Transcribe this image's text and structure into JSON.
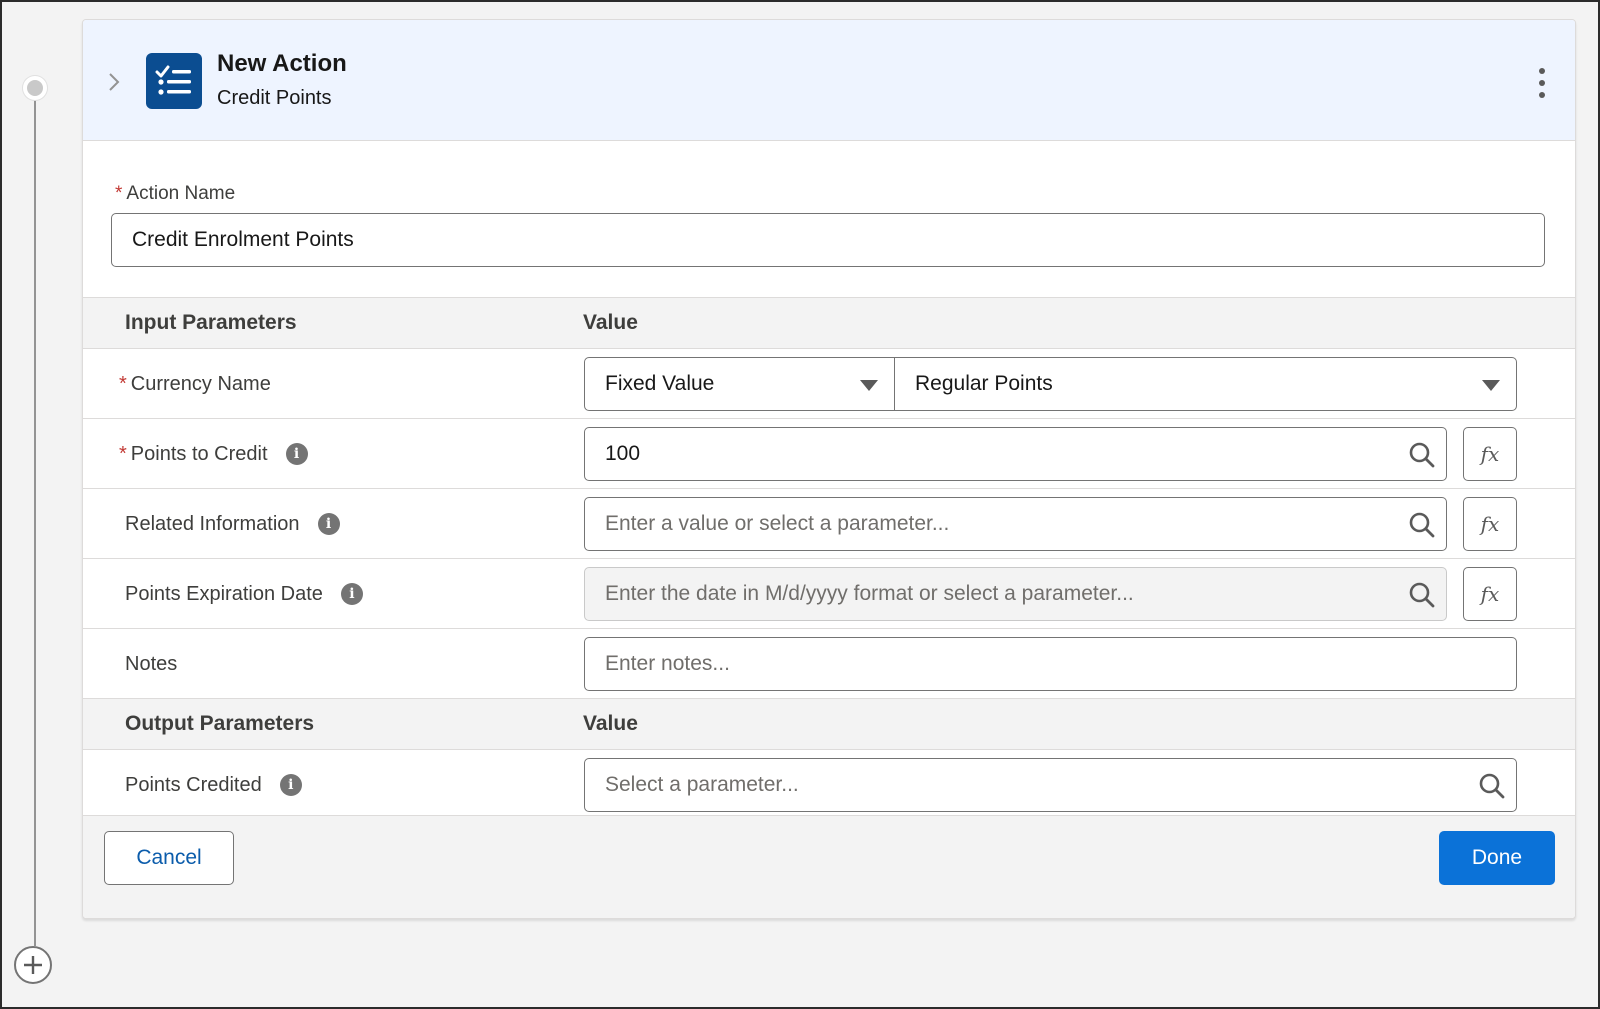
{
  "header": {
    "title": "New Action",
    "subtitle": "Credit Points"
  },
  "action_name": {
    "label": "Action Name",
    "value": "Credit Enrolment Points"
  },
  "input_section": {
    "col1": "Input Parameters",
    "col2": "Value"
  },
  "inputs": {
    "currency": {
      "label": "Currency Name",
      "type_value": "Fixed Value",
      "value": "Regular Points"
    },
    "points_to_credit": {
      "label": "Points to Credit",
      "value": "100"
    },
    "related_info": {
      "label": "Related Information",
      "placeholder": "Enter a value or select a parameter..."
    },
    "expiration": {
      "label": "Points Expiration Date",
      "placeholder": "Enter the date in M/d/yyyy format or select a parameter..."
    },
    "notes": {
      "label": "Notes",
      "placeholder": "Enter notes..."
    }
  },
  "output_section": {
    "col1": "Output Parameters",
    "col2": "Value"
  },
  "outputs": {
    "points_credited": {
      "label": "Points Credited",
      "placeholder": "Select a parameter..."
    }
  },
  "fx_label": "fx",
  "info_glyph": "i",
  "required_mark": "*",
  "footer": {
    "cancel": "Cancel",
    "done": "Done"
  },
  "colors": {
    "header_bg": "#eef4ff",
    "icon_bg": "#0b4d91",
    "primary": "#0b72d8",
    "required": "#c23934"
  }
}
